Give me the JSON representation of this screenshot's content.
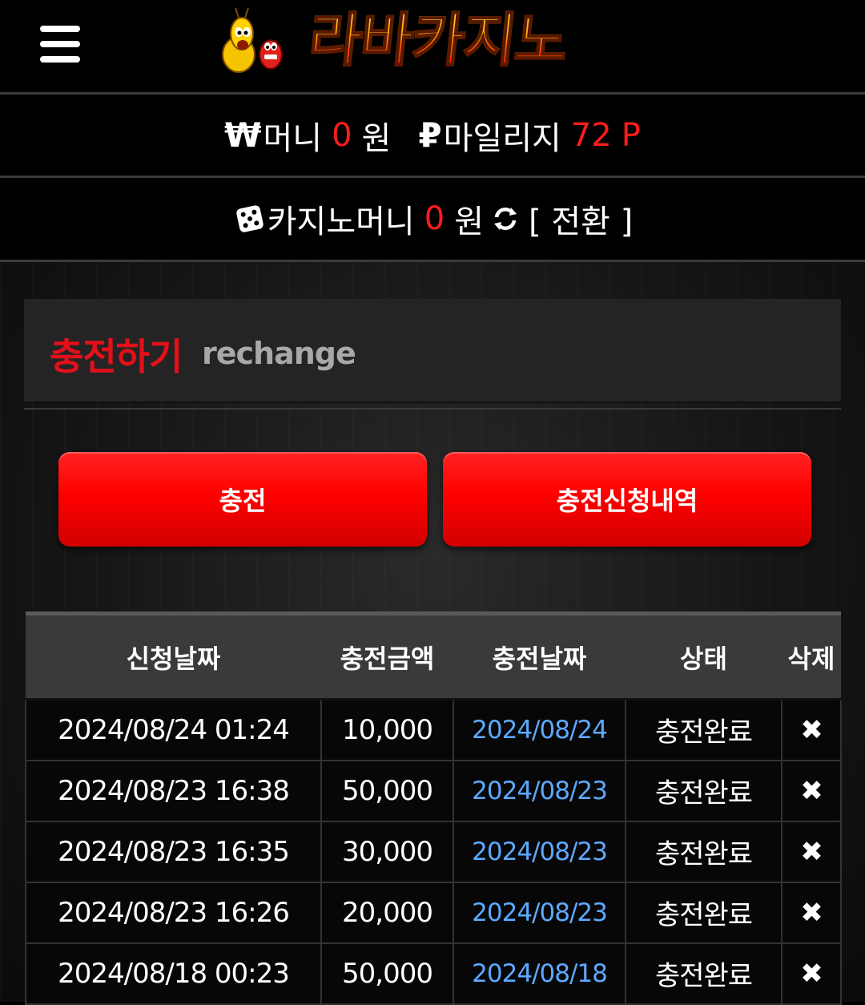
{
  "header": {
    "menu_icon": "hamburger-menu-icon",
    "logo_text": "라바카지노"
  },
  "balance": {
    "money_icon": "₩",
    "money_label": "머니",
    "money_value": "0",
    "money_unit": "원",
    "mileage_icon": "₽",
    "mileage_label": "마일리지",
    "mileage_value": "72",
    "mileage_unit": "P"
  },
  "casino": {
    "dice_icon": "dice-icon",
    "label": "카지노머니",
    "value": "0",
    "unit": "원",
    "refresh_icon": "refresh-icon",
    "switch_label": "[ 전환 ]"
  },
  "page": {
    "title": "충전하기",
    "subtitle": "rechange"
  },
  "buttons": {
    "charge": "충전",
    "history": "충전신청내역"
  },
  "table": {
    "headers": [
      "신청날짜",
      "충전금액",
      "충전날짜",
      "상태",
      "삭제"
    ],
    "rows": [
      {
        "request_date": "2024/08/24 01:24",
        "amount": "10,000",
        "charge_date": "2024/08/24",
        "status": "충전완료"
      },
      {
        "request_date": "2024/08/23 16:38",
        "amount": "50,000",
        "charge_date": "2024/08/23",
        "status": "충전완료"
      },
      {
        "request_date": "2024/08/23 16:35",
        "amount": "30,000",
        "charge_date": "2024/08/23",
        "status": "충전완료"
      },
      {
        "request_date": "2024/08/23 16:26",
        "amount": "20,000",
        "charge_date": "2024/08/23",
        "status": "충전완료"
      },
      {
        "request_date": "2024/08/18 00:23",
        "amount": "50,000",
        "charge_date": "2024/08/18",
        "status": "충전완료"
      }
    ],
    "delete_icon": "close-icon"
  },
  "colors": {
    "accent_red": "#ff1b1b",
    "title_red": "#e3101a",
    "link_blue": "#5da9ff"
  }
}
